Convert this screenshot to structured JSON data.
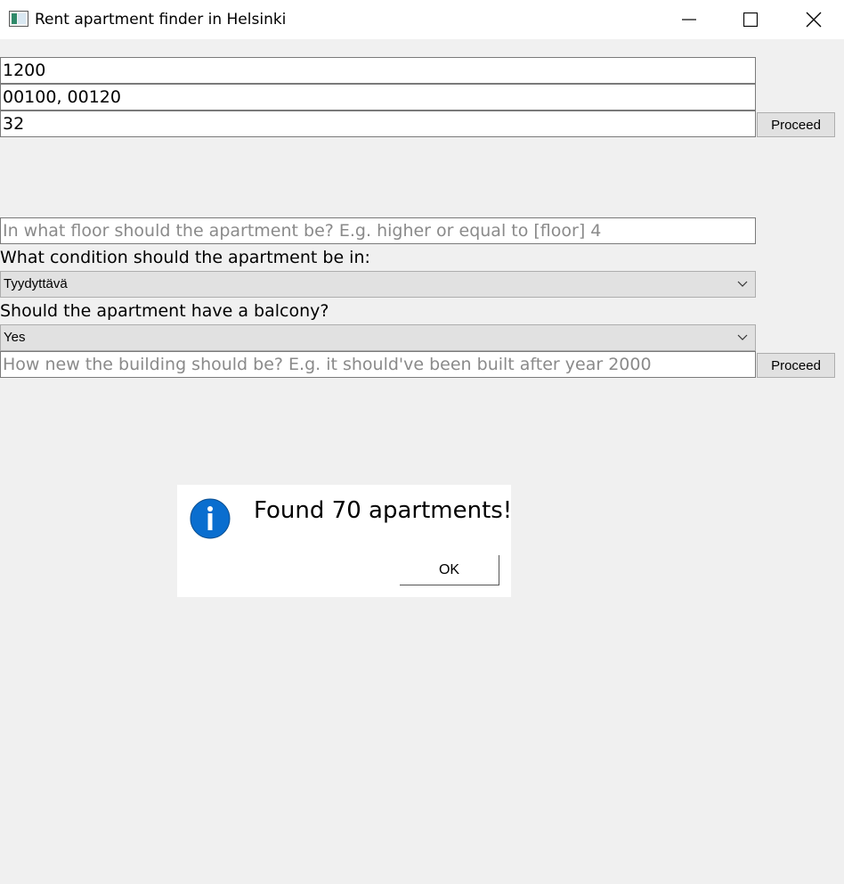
{
  "window": {
    "title": "Rent apartment finder in Helsinki",
    "controls": {
      "minimize": "minimize-icon",
      "maximize": "maximize-icon",
      "close": "close-icon"
    }
  },
  "form1": {
    "rent_value": "1200",
    "postal_codes_value": "00100, 00120",
    "size_value": "32",
    "proceed_label": "Proceed"
  },
  "form2": {
    "floor_placeholder": "In what floor should the apartment be? E.g. higher or equal to [floor] 4",
    "condition_label": "What condition should the apartment be in:",
    "condition_selected": "Tyydyttävä",
    "balcony_label": "Should the apartment have a balcony?",
    "balcony_selected": "Yes",
    "year_placeholder": "How new the building should be? E.g. it should've been built after year 2000",
    "proceed_label": "Proceed"
  },
  "dialog": {
    "icon": "info-icon",
    "message": "Found 70 apartments!",
    "ok_label": "OK",
    "colors": {
      "icon_fill": "#0a6ecf"
    }
  }
}
